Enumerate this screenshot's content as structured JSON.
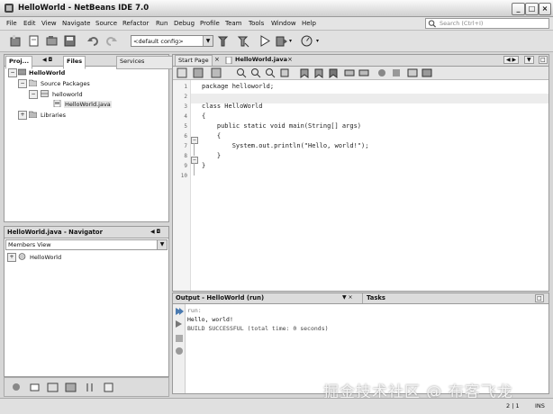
{
  "window": {
    "title": "HelloWorld - NetBeans IDE 7.0"
  },
  "menu": [
    "File",
    "Edit",
    "View",
    "Navigate",
    "Source",
    "Refactor",
    "Run",
    "Debug",
    "Profile",
    "Team",
    "Tools",
    "Window",
    "Help"
  ],
  "search": {
    "placeholder": "Search (Ctrl+I)"
  },
  "toolbar": {
    "config": "<default config>"
  },
  "projects_tabs": [
    {
      "label": "Proj..."
    },
    {
      "label": "Files"
    },
    {
      "label": "Services"
    }
  ],
  "project_tree": [
    {
      "label": "HelloWorld",
      "icon": "project-icon"
    },
    {
      "label": "Source Packages",
      "icon": "folder-icon"
    },
    {
      "label": "helloworld",
      "icon": "package-icon"
    },
    {
      "label": "HelloWorld.java",
      "icon": "java-file-icon"
    },
    {
      "label": "Libraries",
      "icon": "library-icon"
    }
  ],
  "navigator": {
    "title": "HelloWorld.java - Navigator",
    "view": "Members View",
    "item": "HelloWorld"
  },
  "editor": {
    "tabs": [
      {
        "label": "Start Page"
      },
      {
        "label": "HelloWorld.java"
      }
    ],
    "line_numbers": [
      "1",
      "2",
      "3",
      "4",
      "5",
      "6",
      "7",
      "8",
      "9",
      "10"
    ],
    "lines": [
      "package helloworld;",
      "",
      "class HelloWorld",
      "{",
      "    public static void main(String[] args)",
      "    {",
      "        System.out.println(\"Hello, world!\");",
      "    }",
      "}",
      ""
    ]
  },
  "output": {
    "title": "Output - HelloWorld (run)",
    "tasks_label": "Tasks",
    "lines": [
      "run:",
      "Hello, world!",
      "BUILD SUCCESSFUL (total time: 0 seconds)"
    ]
  },
  "status": {
    "position": "2 | 1",
    "mode": "INS"
  },
  "watermark": "掘金技术社区 @ 布客飞龙",
  "colors": {
    "titlebar": "#d8d8d8",
    "panel": "#ffffff",
    "run_icon": "#4a7ab0"
  }
}
